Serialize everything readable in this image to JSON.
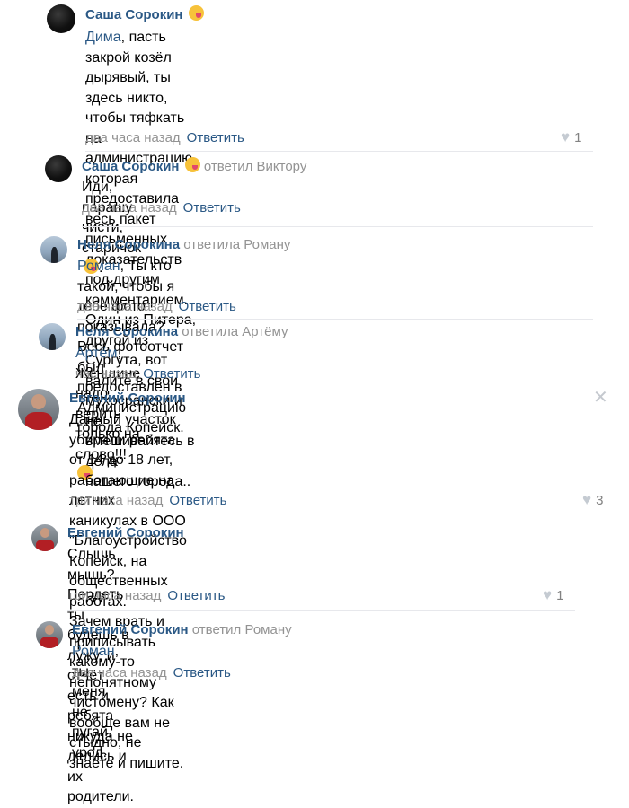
{
  "reply_label": "Ответить",
  "comments": [
    {
      "author": "Саша Сорокин",
      "replied_to": "",
      "mention": "Дима",
      "lines": [
        ", пасть закрой козёл дырявый, ты здесь никто, чтобы тяфкать на",
        "администрацию, которая предоставила весь пакет письменных",
        "доказательств под другим комментарием. Один из Питера, другой из",
        "Сургута, вот валите в свои мухосрански и не вмешивайтесь в дела",
        "нашего города.."
      ],
      "time": "два часа назад",
      "likes": "1"
    },
    {
      "author": "Саша Сорокин",
      "replied_to": "ответил Виктору",
      "mention": "",
      "lines": [
        "Иди, парашу чисти, старичок"
      ],
      "time": "два часа назад",
      "likes": ""
    },
    {
      "author": "Неля Сорокина",
      "replied_to": "ответила Роману",
      "mention": "Роман",
      "lines": [
        ", Ты кто такой, чтобы я тебе фото показывала? Весь фотоотчет",
        "был предоставлен в Администрацию города Копейск."
      ],
      "time": "два часа назад",
      "likes": ""
    },
    {
      "author": "Неля Сорокина",
      "replied_to": "ответила Артёму",
      "mention": "Артём",
      "lines": [
        ", Женщине надо верить только на слово!!!"
      ],
      "time": "час назад",
      "likes": ""
    },
    {
      "author": "Евгений Сорокин",
      "replied_to": "",
      "mention": "",
      "lines": [
        "Данный участок убирали ребята от 14 до 18 лет, работающие на летних",
        "каникулах в ООО \"Благоустройство Копейск, на общественных работах.",
        "Зачем врать и приписывать какому-то непонятному чистомену? Как",
        "вообще вам не стыдно, не знаете и пишите."
      ],
      "time": "три часа назад",
      "likes": "3"
    },
    {
      "author": "Евгений Сорокин",
      "replied_to": "",
      "mention": "",
      "lines": [
        "Слышь мышь? Пердеть ты будешь в лужу, и отчёт есть и ребята",
        "никуда не делись и их родители."
      ],
      "time": "три часа назад",
      "likes": "1"
    },
    {
      "author": "Евгений Сорокин",
      "replied_to": "ответил Роману",
      "mention": "Роман",
      "lines": [
        ", ты меня не пугай, урод."
      ],
      "time": "два часа назад",
      "likes": ""
    }
  ],
  "icons": {
    "like": "heart-icon",
    "close": "close-icon",
    "emoji_tongue": "tongue-emoji-icon",
    "emoji_wink": "wink-emoji-icon",
    "emoji_joy": "tears-of-joy-emoji-icon"
  },
  "colors": {
    "link": "#2a5885",
    "muted": "#939393",
    "divider": "#e7e8ec"
  }
}
